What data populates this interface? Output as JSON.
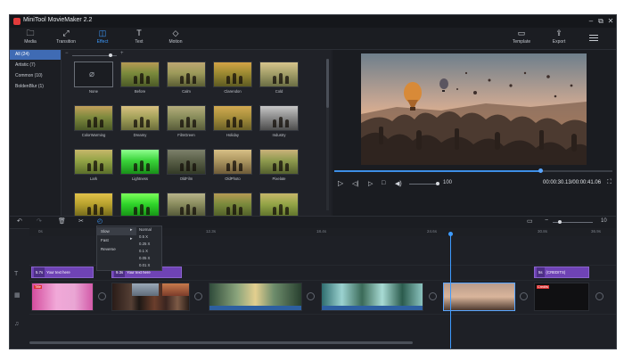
{
  "app": {
    "title": "MiniTool MovieMaker 2.2"
  },
  "window_controls": {
    "minimize": "–",
    "maximize": "⧉",
    "close": "✕"
  },
  "toolbar": {
    "left": [
      {
        "id": "media",
        "label": "Media",
        "icon": "folder-icon",
        "glyph": "🗀"
      },
      {
        "id": "transition",
        "label": "Transition",
        "icon": "transition-icon",
        "glyph": "⤢"
      },
      {
        "id": "effect",
        "label": "Effect",
        "icon": "effect-icon",
        "glyph": "◫",
        "active": true
      },
      {
        "id": "text",
        "label": "Text",
        "icon": "text-icon",
        "glyph": "T"
      },
      {
        "id": "motion",
        "label": "Motion",
        "icon": "motion-icon",
        "glyph": "◇"
      }
    ],
    "right": [
      {
        "id": "template",
        "label": "Template",
        "icon": "template-icon",
        "glyph": "▭"
      },
      {
        "id": "export",
        "label": "Export",
        "icon": "export-icon",
        "glyph": "⇪"
      }
    ],
    "menu_icon": "hamburger-icon"
  },
  "categories": [
    {
      "label": "All (24)",
      "active": true
    },
    {
      "label": "Artistic (7)"
    },
    {
      "label": "Common (10)"
    },
    {
      "label": "BoldenBlur (1)"
    }
  ],
  "effects": [
    {
      "name": "None",
      "style": "none"
    },
    {
      "name": "Before",
      "style": "warm"
    },
    {
      "name": "Calm",
      "style": "calm"
    },
    {
      "name": "Clarendon",
      "style": "clarendon"
    },
    {
      "name": "Cold",
      "style": "cold"
    },
    {
      "name": "ColorWarming",
      "style": "warm2"
    },
    {
      "name": "Dreamy",
      "style": "dreamy"
    },
    {
      "name": "FilmGreen",
      "style": "filmgreen"
    },
    {
      "name": "Holiday",
      "style": "holiday"
    },
    {
      "name": "Industry",
      "style": "gray"
    },
    {
      "name": "Lark",
      "style": "lark"
    },
    {
      "name": "Lightness",
      "style": "lightness"
    },
    {
      "name": "OldFilm",
      "style": "oldfilm"
    },
    {
      "name": "OldPhoto",
      "style": "oldphoto"
    },
    {
      "name": "Pixelate",
      "style": "pixelate"
    },
    {
      "name": "",
      "style": "yellow"
    },
    {
      "name": "",
      "style": "green"
    },
    {
      "name": "",
      "style": "olive"
    },
    {
      "name": "",
      "style": "warm"
    },
    {
      "name": "",
      "style": "lark"
    }
  ],
  "player": {
    "time": "00:00:30.13/00:00:41.06",
    "volume": "100",
    "progress_fraction": 0.74
  },
  "timeline_toolbar": {
    "zoom_value": "10"
  },
  "speed_menu": {
    "items": [
      {
        "label": "Slow",
        "highlighted": true
      },
      {
        "label": "Fast"
      },
      {
        "label": "Reverse"
      }
    ],
    "sub": [
      "Normal",
      "0.5 X",
      "0.25 X",
      "0.1 X",
      "0.05 X",
      "0.01 X"
    ]
  },
  "ruler": [
    "0s",
    "6.2s",
    "12.3s",
    "18.4s",
    "24.6s",
    "30.8s",
    "36.9s",
    "43.0s"
  ],
  "title_clips": [
    {
      "dur": "5.7s",
      "text": "Your text here"
    },
    {
      "dur": "9.3s",
      "text": "Your text here"
    },
    {
      "dur": "5s",
      "text": "(CREDITS)"
    }
  ],
  "badges": {
    "first": "Title",
    "last": "Credits"
  },
  "colors": {
    "accent": "#3d9bff",
    "active_category": "#3f6bb4",
    "title_clip": "#6f43b5"
  }
}
